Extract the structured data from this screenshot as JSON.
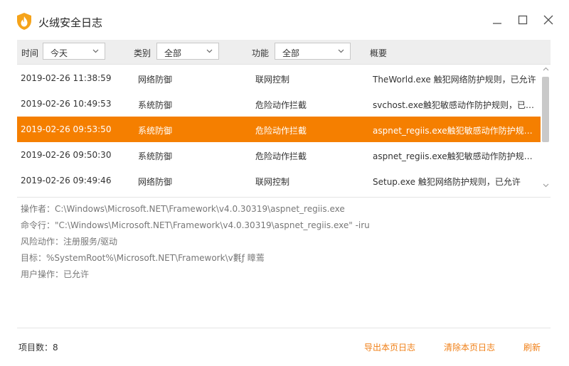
{
  "window": {
    "title": "火绒安全日志",
    "accent_color": "#f57f00",
    "logo_icon": "huorong-shield-flame-icon",
    "controls": [
      "minimize-icon",
      "maximize-icon",
      "close-icon"
    ]
  },
  "filters": {
    "time_label": "时间",
    "time_value": "今天",
    "category_label": "类别",
    "category_value": "全部",
    "function_label": "功能",
    "function_value": "全部",
    "summary_label": "概要"
  },
  "rows": [
    {
      "time": "2019-02-26 11:38:59",
      "category": "网络防御",
      "function": "联网控制",
      "summary": "TheWorld.exe 触犯网络防护规则，已允许"
    },
    {
      "time": "2019-02-26 10:49:53",
      "category": "系统防御",
      "function": "危险动作拦截",
      "summary": "svchost.exe触犯敏感动作防护规则，已允许"
    },
    {
      "time": "2019-02-26 09:53:50",
      "category": "系统防御",
      "function": "危险动作拦截",
      "summary": "aspnet_regiis.exe触犯敏感动作防护规则, ..."
    },
    {
      "time": "2019-02-26 09:50:30",
      "category": "系统防御",
      "function": "危险动作拦截",
      "summary": "aspnet_regiis.exe触犯敏感动作防护规则, ..."
    },
    {
      "time": "2019-02-26 09:49:46",
      "category": "网络防御",
      "function": "联网控制",
      "summary": "Setup.exe 触犯网络防护规则，已允许"
    }
  ],
  "selected_row": 2,
  "detail": {
    "operator": "操作者：C:\\Windows\\Microsoft.NET\\Framework\\v4.0.30319\\aspnet_regiis.exe",
    "command": "命令行：\"C:\\Windows\\Microsoft.NET\\Framework\\v4.0.30319\\aspnet_regiis.exe\" -iru",
    "risk_action": "风险动作：注册服务/驱动",
    "target": "目标：%SystemRoot%\\Microsoft.NET\\Framework\\v氀ƒ 瞕蔫",
    "user_action": "用户操作：已允许"
  },
  "footer": {
    "item_count": "项目数：8",
    "export_label": "导出本页日志",
    "clear_label": "清除本页日志",
    "refresh_label": "刷新"
  }
}
